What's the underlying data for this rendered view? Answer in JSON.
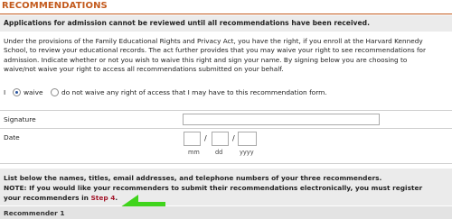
{
  "section": {
    "title": "RECOMMENDATIONS",
    "notice": "Applications for admission cannot be reviewed until all recommendations have been received."
  },
  "privacy": {
    "line1": "Under the provisions of the Family Educational Rights and Privacy Act, you have the right, if you enroll at the Harvard Kennedy",
    "line2": "School, to review your educational records. The act further provides that you may waive your right to see recommendations for",
    "line3": "admission. Indicate whether or not you wish to waive this right and sign your name. By signing below you are choosing to",
    "line4": "waive/not waive your right to access all recommendations submitted on your behalf."
  },
  "waiver": {
    "prefix": "I",
    "option_waive": "waive",
    "option_not_waive": "do not waive any right of access that I may have to this recommendation form.",
    "selected": "waive"
  },
  "signature": {
    "label": "Signature",
    "value": ""
  },
  "date": {
    "label": "Date",
    "mm_label": "mm",
    "dd_label": "dd",
    "yyyy_label": "yyyy",
    "separator": "/"
  },
  "instructions": {
    "line1": "List below the names, titles, email addresses, and telephone numbers of your three recommenders.",
    "line2": "NOTE: If you would like your recommenders to submit their recommendations electronically, you must register",
    "line3_prefix": "your recommenders in",
    "step_link": "Step 4",
    "line3_suffix": "."
  },
  "recommender": {
    "heading": "Recommender 1"
  },
  "colors": {
    "title": "#c35a1d",
    "link": "#a3172b",
    "arrow": "#3fd41b"
  }
}
